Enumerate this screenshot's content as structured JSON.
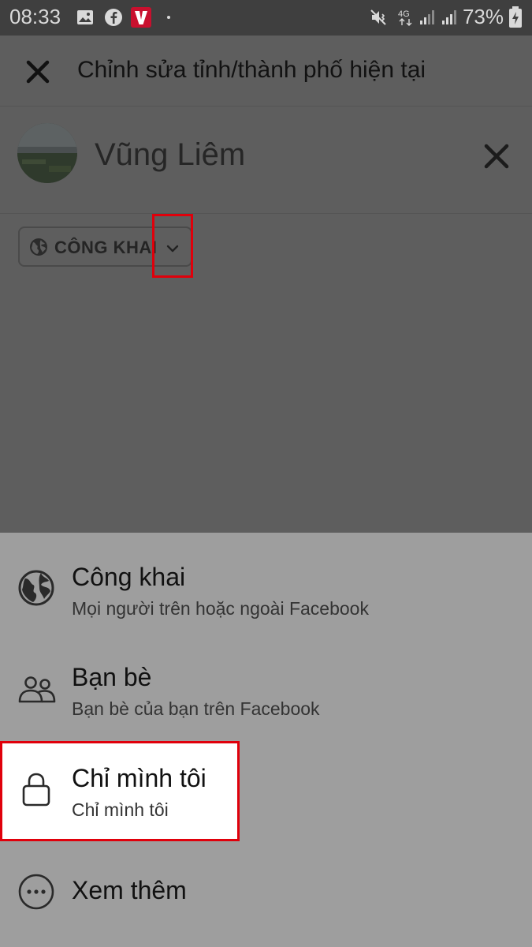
{
  "status_bar": {
    "time": "08:33",
    "battery": "73%",
    "network": "4G",
    "icons": [
      "image-icon",
      "facebook-icon",
      "v-app-icon",
      "dot-icon",
      "mute-vibrate-icon",
      "network-4g-icon",
      "signal-icon",
      "signal-icon",
      "battery-charging-icon"
    ]
  },
  "appbar": {
    "title": "Chỉnh sửa tỉnh/thành phố hiện tại",
    "close_icon": "close-icon"
  },
  "location": {
    "name": "Vũng Liêm",
    "clear_icon": "close-icon"
  },
  "privacy": {
    "label": "CÔNG KHAI",
    "icon": "globe-icon",
    "chevron": "chevron-down-icon"
  },
  "sheet": {
    "options": [
      {
        "title": "Công khai",
        "subtitle": "Mọi người trên hoặc ngoài Facebook",
        "icon": "globe-icon"
      },
      {
        "title": "Bạn bè",
        "subtitle": "Bạn bè của bạn trên Facebook",
        "icon": "friends-icon"
      },
      {
        "title": "Chỉ mình tôi",
        "subtitle": "Chỉ mình tôi",
        "icon": "lock-icon"
      },
      {
        "title": "Xem thêm",
        "subtitle": "",
        "icon": "more-icon"
      }
    ]
  },
  "colors": {
    "highlight": "#e0000b",
    "overlay": "#5e5e5e",
    "sheet": "#9e9e9e"
  }
}
